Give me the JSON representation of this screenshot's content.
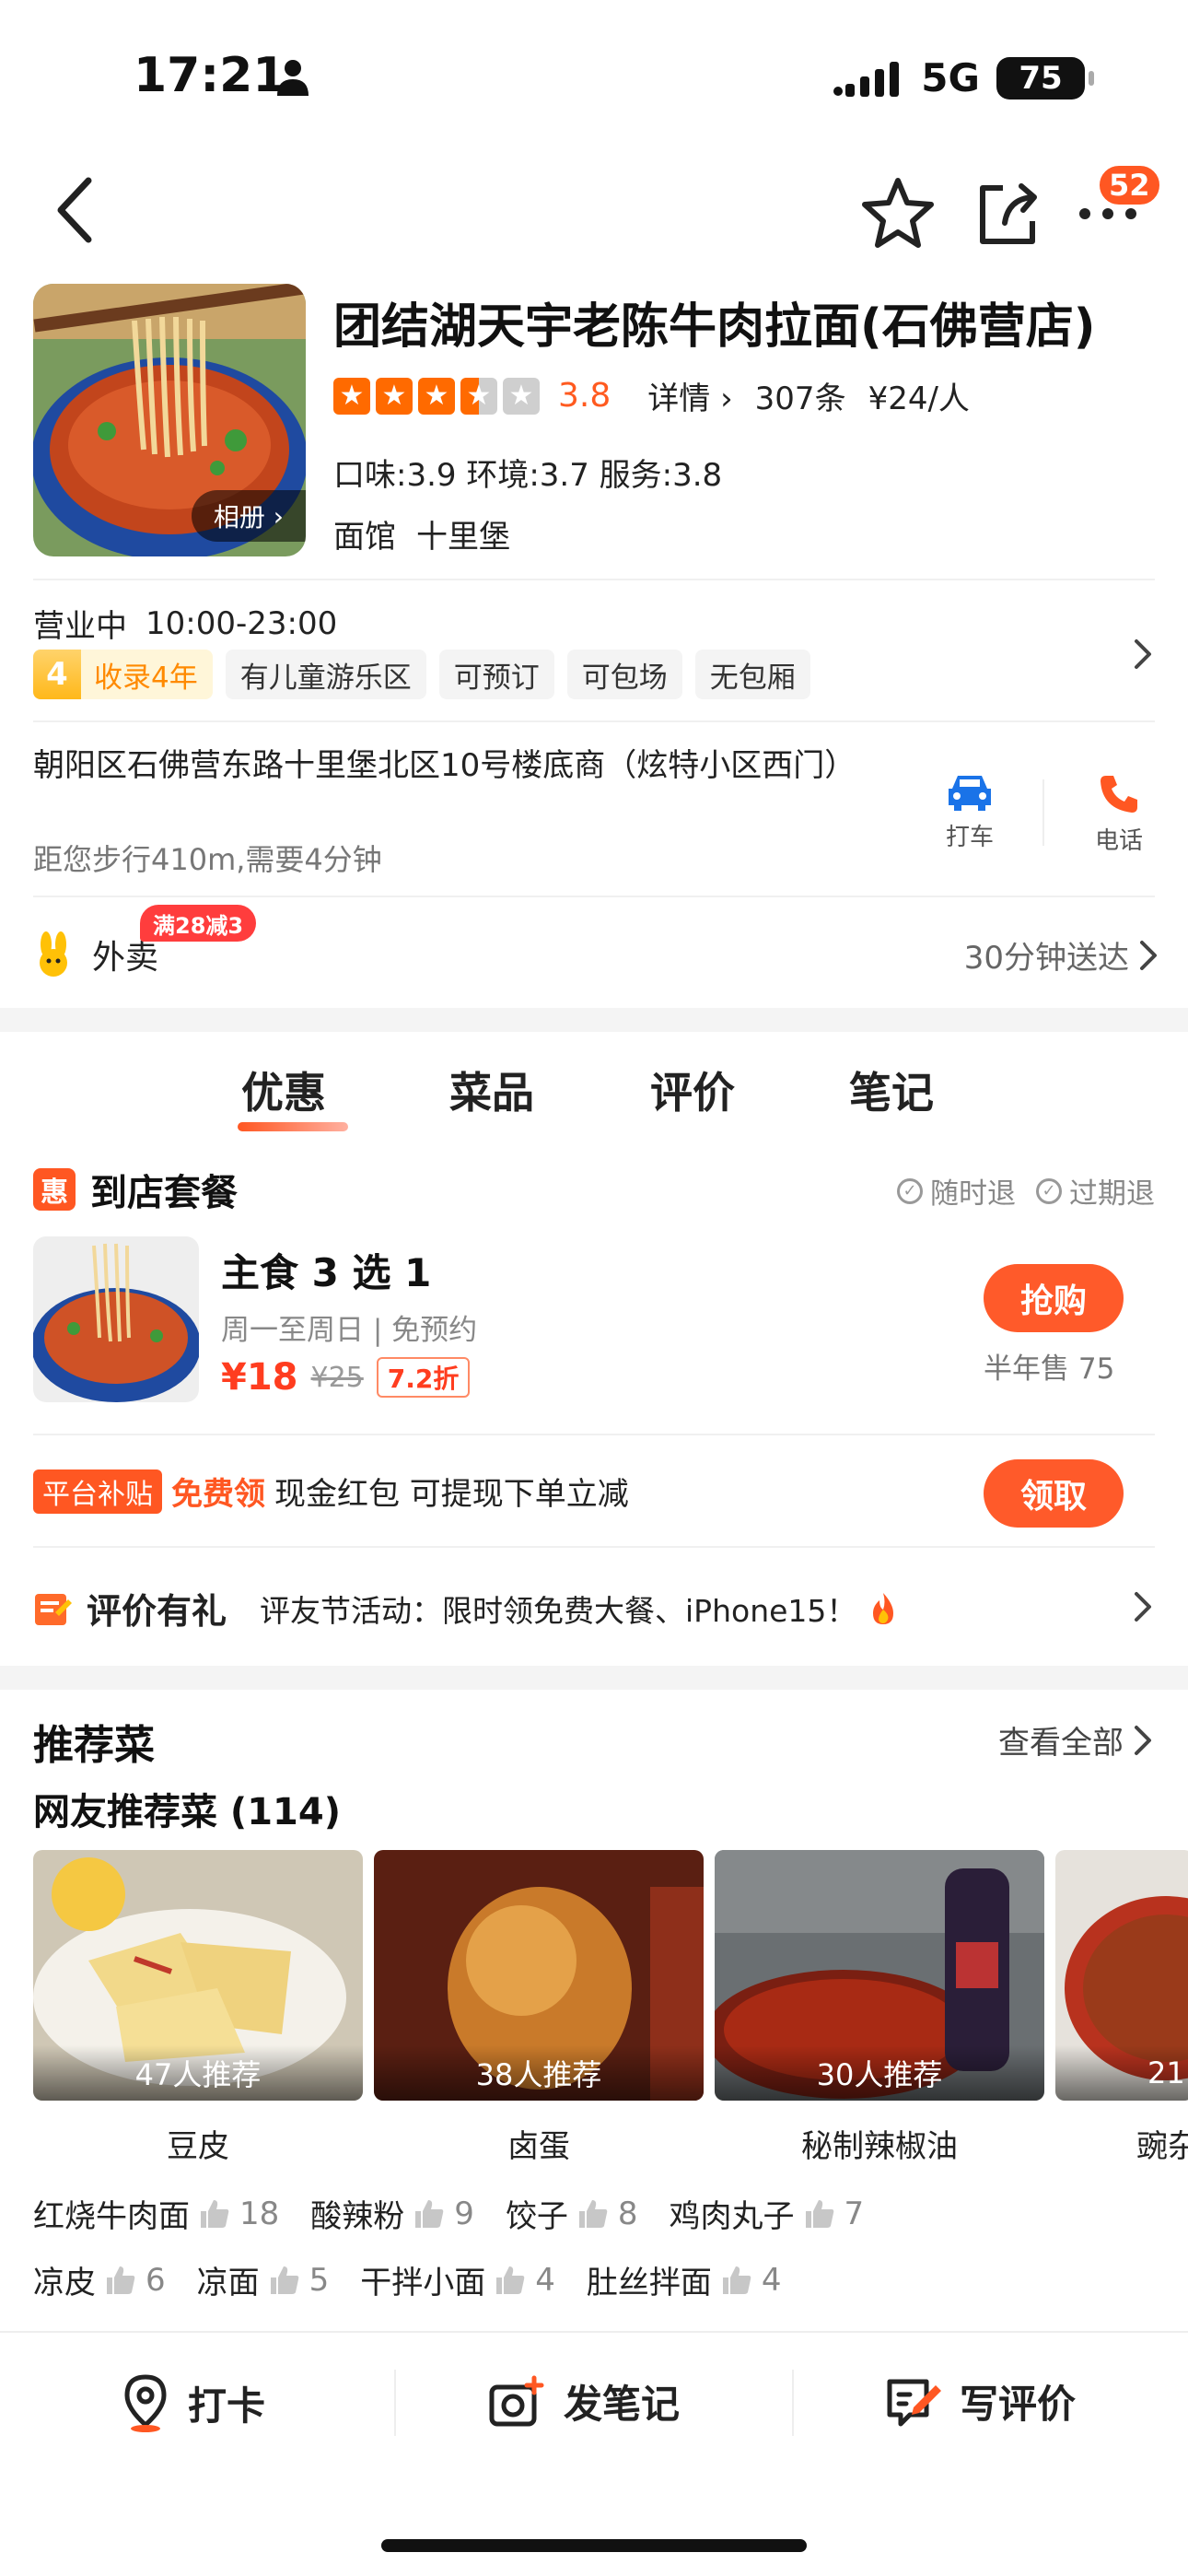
{
  "status": {
    "time": "17:21",
    "network": "5G",
    "battery": "75"
  },
  "nav": {
    "badge": "52"
  },
  "shop": {
    "name": "团结湖天宇老陈牛肉拉面(石佛营店)",
    "album": "相册",
    "rating": "3.8",
    "detail": "详情",
    "reviews": "307条",
    "price": "¥24/人",
    "scores": "口味:3.9  环境:3.7  服务:3.8",
    "category": "面馆",
    "area": "十里堡"
  },
  "info": {
    "hours_status": "营业中",
    "hours": "10:00-23:00",
    "years_num": "4",
    "years_label": "收录4年",
    "tags": [
      "有儿童游乐区",
      "可预订",
      "可包场",
      "无包厢"
    ],
    "address": "朝阳区石佛营东路十里堡北区10号楼底商（炫特小区西门）",
    "distance": "距您步行410m,需要4分钟",
    "taxi": "打车",
    "phone": "电话"
  },
  "takeaway": {
    "label": "外卖",
    "deal": "满28减3",
    "delivery": "30分钟送达"
  },
  "tabs": [
    "优惠",
    "菜品",
    "评价",
    "笔记"
  ],
  "package": {
    "icon_text": "惠",
    "title": "到店套餐",
    "guarantee1": "随时退",
    "guarantee2": "过期退",
    "name": "主食 3 选 1",
    "sub": "周一至周日 | 免预约",
    "price": "¥18",
    "old_price": "¥25",
    "discount": "7.2折",
    "buy": "抢购",
    "sold": "半年售 75"
  },
  "subsidy": {
    "tag": "平台补贴",
    "free": "免费领",
    "text": "现金红包 可提现下单立减",
    "button": "领取"
  },
  "review_promo": {
    "title": "评价有礼",
    "text": "评友节活动：限时领免费大餐、iPhone15！"
  },
  "recommend": {
    "title": "推荐菜",
    "view_all": "查看全部",
    "subtitle": "网友推荐菜 (114)",
    "dishes": [
      {
        "name": "豆皮",
        "rec": "47人推荐"
      },
      {
        "name": "卤蛋",
        "rec": "38人推荐"
      },
      {
        "name": "秘制辣椒油",
        "rec": "30人推荐"
      },
      {
        "name": "豌杂",
        "rec": "21"
      }
    ],
    "chips_row1": [
      {
        "name": "红烧牛肉面",
        "count": "18"
      },
      {
        "name": "酸辣粉",
        "count": "9"
      },
      {
        "name": "饺子",
        "count": "8"
      },
      {
        "name": "鸡肉丸子",
        "count": "7"
      }
    ],
    "chips_row2": [
      {
        "name": "凉皮",
        "count": "6"
      },
      {
        "name": "凉面",
        "count": "5"
      },
      {
        "name": "干拌小面",
        "count": "4"
      },
      {
        "name": "肚丝拌面",
        "count": "4"
      }
    ]
  },
  "bottom": {
    "checkin": "打卡",
    "note": "发笔记",
    "review": "写评价"
  },
  "colors": {
    "accent": "#ff5722",
    "price": "#ff3d1f"
  }
}
